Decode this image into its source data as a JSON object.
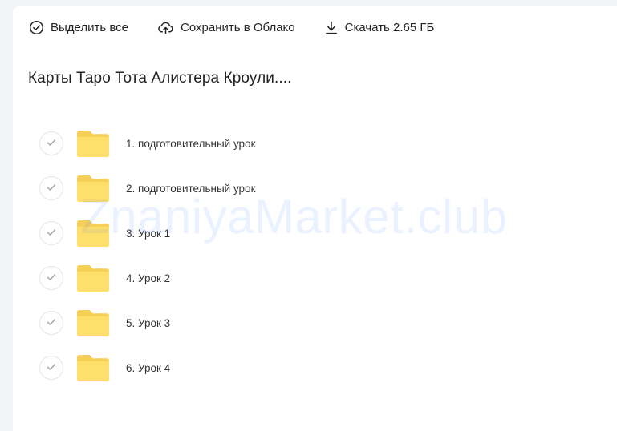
{
  "toolbar": {
    "select_all": {
      "label": "Выделить все",
      "icon": "check-circle-icon"
    },
    "save_to_cloud": {
      "label": "Сохранить в Облако",
      "icon": "cloud-upload-icon"
    },
    "download": {
      "label": "Скачать 2.65 ГБ",
      "icon": "download-icon"
    }
  },
  "title": "Карты Таро Тота Алистера Кроули....",
  "watermark": "ZnaniyaMarket.club",
  "items": [
    {
      "name": "1. подготовительный урок",
      "icon": "folder-icon"
    },
    {
      "name": "2. подготовительный урок",
      "icon": "folder-icon"
    },
    {
      "name": "3. Урок 1",
      "icon": "folder-icon"
    },
    {
      "name": "4. Урок 2",
      "icon": "folder-icon"
    },
    {
      "name": "5. Урок 3",
      "icon": "folder-icon"
    },
    {
      "name": "6. Урок 4",
      "icon": "folder-icon"
    }
  ],
  "colors": {
    "folder": "#ffdf6b",
    "folder_tab": "#f5cf56",
    "watermark": "#2a7bff"
  }
}
